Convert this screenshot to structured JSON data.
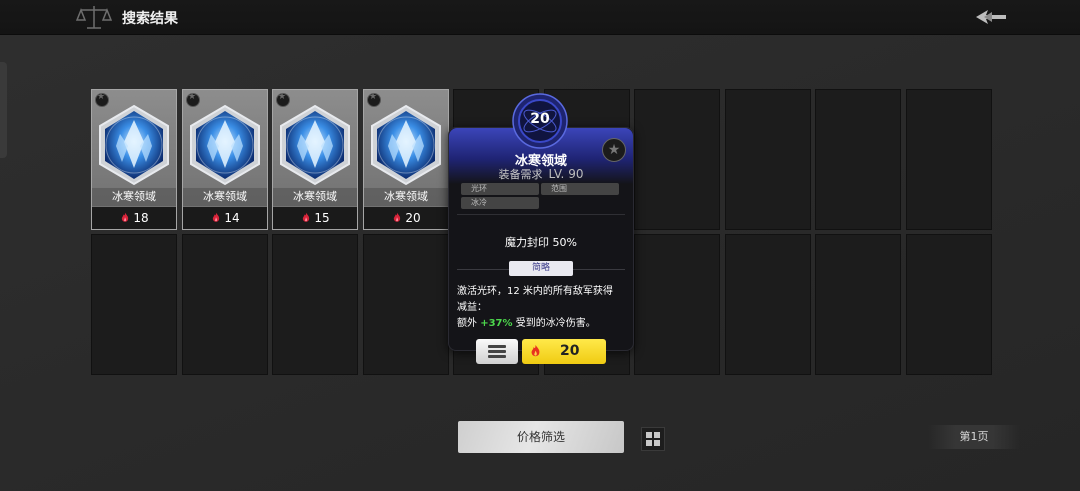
{
  "header": {
    "title": "搜索结果"
  },
  "items": [
    {
      "name": "冰寒领域",
      "price": "18"
    },
    {
      "name": "冰寒领域",
      "price": "14"
    },
    {
      "name": "冰寒领域",
      "price": "15"
    },
    {
      "name": "冰寒领域",
      "price": "20"
    }
  ],
  "tooltip": {
    "tier": "20",
    "name": "冰寒领域",
    "requirement_label": "装备需求",
    "requirement_level": "LV. 90",
    "tags": [
      "光环",
      "范围",
      "冰冷"
    ],
    "stat": "魔力封印  50%",
    "brief_label": "简略",
    "desc_line1": "激活光环，12 米内的所有敌军获得",
    "desc_line2": "减益：",
    "desc_pre": "额外 ",
    "desc_highlight": "+37%",
    "desc_post": " 受到的冰冷伤害。",
    "price": "20"
  },
  "footer": {
    "filter_label": "价格筛选",
    "page_label": "第1页"
  },
  "colors": {
    "accent_blue": "#3b45b9",
    "buy_yellow": "#f0cb12",
    "highlight_green": "#4cd64c"
  },
  "icons": {
    "scale": "scale-icon",
    "back": "back-arrow-icon",
    "gem": "ice-crystal-gem-icon",
    "currency": "flame-currency-icon",
    "menu": "menu-lines-icon",
    "grid": "grid-layout-icon",
    "favorite": "star-icon"
  }
}
